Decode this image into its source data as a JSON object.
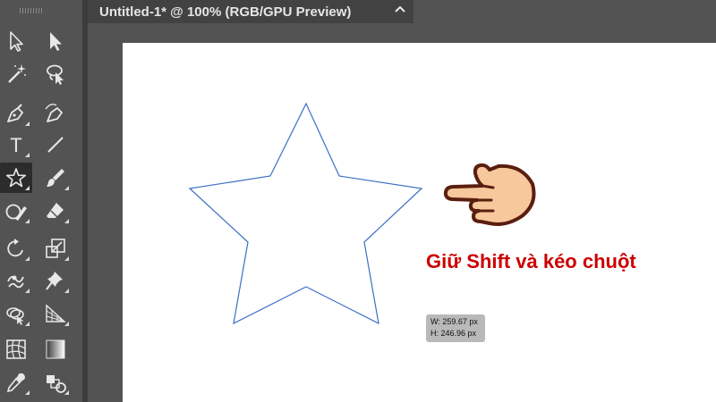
{
  "document_tab": {
    "title": "Untitled-1* @ 100% (RGB/GPU Preview)",
    "close_icon": "close-icon"
  },
  "toolbar": {
    "tools": [
      {
        "name": "selection-tool",
        "icon": "arrow-outline-icon"
      },
      {
        "name": "direct-selection-tool",
        "icon": "arrow-filled-icon"
      },
      {
        "name": "magic-wand-tool",
        "icon": "magic-wand-icon"
      },
      {
        "name": "lasso-tool",
        "icon": "lasso-icon"
      },
      {
        "name": "pen-tool",
        "icon": "pen-icon"
      },
      {
        "name": "curvature-tool",
        "icon": "curvature-pen-icon"
      },
      {
        "name": "type-tool",
        "icon": "type-icon",
        "label": "T"
      },
      {
        "name": "line-tool",
        "icon": "line-icon"
      },
      {
        "name": "star-tool",
        "icon": "star-icon",
        "active": true
      },
      {
        "name": "paintbrush-tool",
        "icon": "brush-icon"
      },
      {
        "name": "shaper-tool",
        "icon": "shaper-icon"
      },
      {
        "name": "eraser-tool",
        "icon": "eraser-icon"
      },
      {
        "name": "rotate-tool",
        "icon": "rotate-icon"
      },
      {
        "name": "scale-tool",
        "icon": "scale-icon"
      },
      {
        "name": "warp-tool",
        "icon": "warp-icon"
      },
      {
        "name": "puppet-warp-tool",
        "icon": "pin-icon"
      },
      {
        "name": "shape-builder-tool",
        "icon": "shape-builder-icon"
      },
      {
        "name": "perspective-grid-tool",
        "icon": "perspective-grid-icon"
      },
      {
        "name": "mesh-tool",
        "icon": "mesh-icon"
      },
      {
        "name": "gradient-tool",
        "icon": "gradient-icon"
      },
      {
        "name": "eyedropper-tool",
        "icon": "eyedropper-icon"
      },
      {
        "name": "blend-tool",
        "icon": "blend-icon"
      }
    ]
  },
  "canvas": {
    "shape": "star",
    "stroke_color": "#3a6fc4",
    "hint_text": "Giữ Shift và kéo chuột",
    "hint_color": "#cc0000",
    "hand_icon": "pointing-hand-icon",
    "dimensions": {
      "width": "W: 259.67 px",
      "height": "H: 246.96 px"
    }
  }
}
